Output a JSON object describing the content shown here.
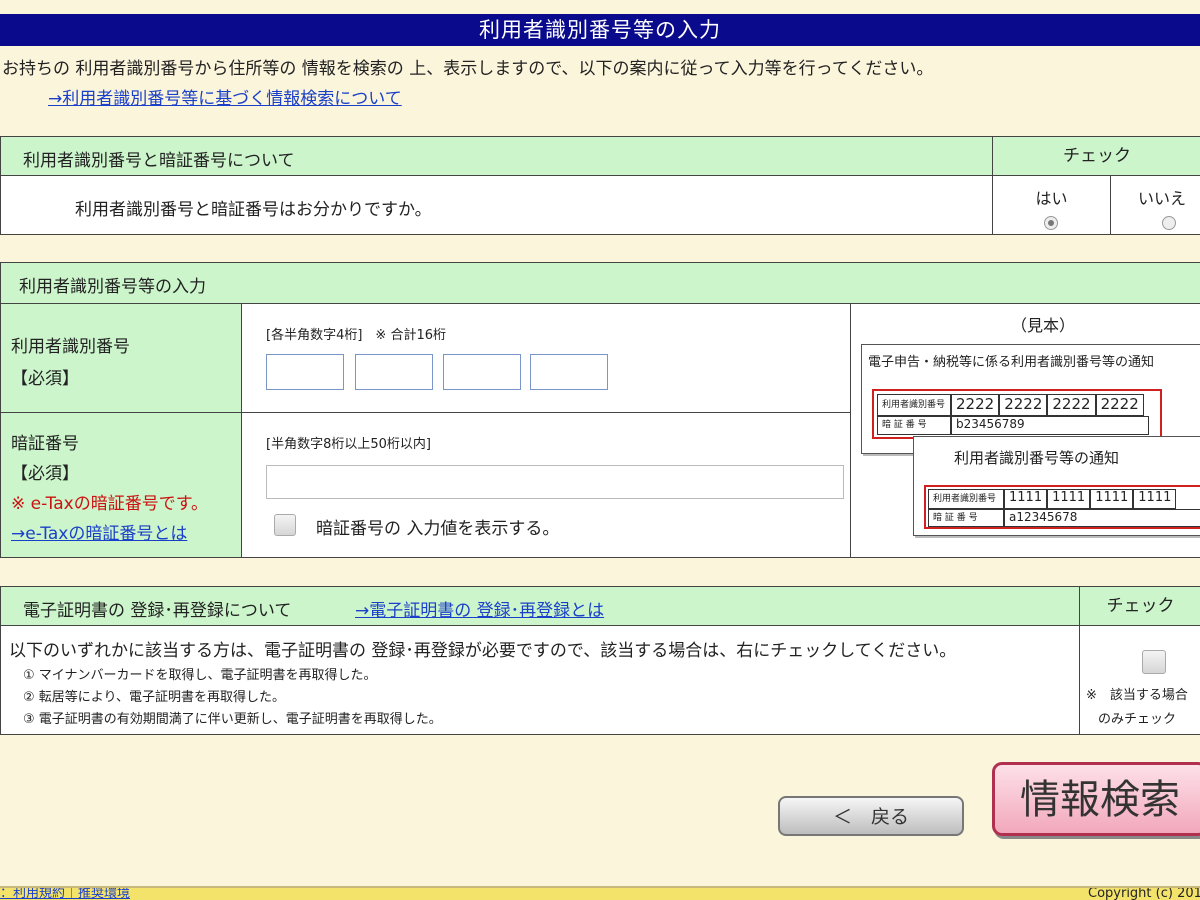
{
  "title": "利用者識別番号等の入力",
  "intro": {
    "text": "お持ちの 利用者識別番号から住所等の 情報を検索の 上、表示しますので、以下の案内に従って入力等を行ってください。",
    "link": "→利用者識別番号等に基づく情報検索について"
  },
  "section1": {
    "header": "利用者識別番号と暗証番号について",
    "check_header": "チェック",
    "question": "利用者識別番号と暗証番号はお分かりですか。",
    "yes_label": "はい",
    "no_label": "いいえ",
    "selected": "yes"
  },
  "section2": {
    "header": "利用者識別番号等の入力",
    "user_id": {
      "label": "利用者識別番号",
      "required": "【必須】",
      "hint": "[各半角数字4桁]　※ 合計16桁",
      "values": [
        "",
        "",
        "",
        ""
      ]
    },
    "pin": {
      "label": "暗証番号",
      "required": "【必須】",
      "note": "※ e-Taxの暗証番号です。",
      "link": "→e-Taxの暗証番号とは",
      "hint": "[半角数字8桁以上50桁以内]",
      "value": "",
      "show_label": "暗証番号の 入力値を表示する。"
    },
    "sample": {
      "title": "（見本）",
      "card1": {
        "heading": "電子申告・納税等に係る利用者識別番号等の通知",
        "row1_label": "利用者識別番号",
        "row1_values": [
          "2222",
          "2222",
          "2222",
          "2222"
        ],
        "row2_label": "暗 証 番 号",
        "row2_value": "b23456789"
      },
      "card2": {
        "heading": "利用者識別番号等の通知",
        "row1_label": "利用者識別番号",
        "row1_values": [
          "1111",
          "1111",
          "1111",
          "1111"
        ],
        "row2_label": "暗 証 番 号",
        "row2_value": "a12345678"
      }
    }
  },
  "section3": {
    "header": "電子証明書の 登録･再登録について",
    "header_link": "→電子証明書の 登録･再登録とは",
    "check_header": "チェック",
    "body": "以下のいずれかに該当する方は、電子証明書の 登録･再登録が必要ですので、該当する場合は、右にチェックしてください。",
    "items": [
      "① マイナンバーカードを取得し、電子証明書を再取得した。",
      "② 転居等により、電子証明書を再取得した。",
      "③ 電子証明書の有効期間満了に伴い更新し、電子証明書を再取得した。"
    ],
    "check_note_1": "※　該当する場合",
    "check_note_2": "のみチェック"
  },
  "buttons": {
    "back": "＜　戻る",
    "search": "情報検索"
  },
  "footer": {
    "links": "：利用規約｜推奨環境",
    "copyright": "Copyright (c) 201"
  }
}
